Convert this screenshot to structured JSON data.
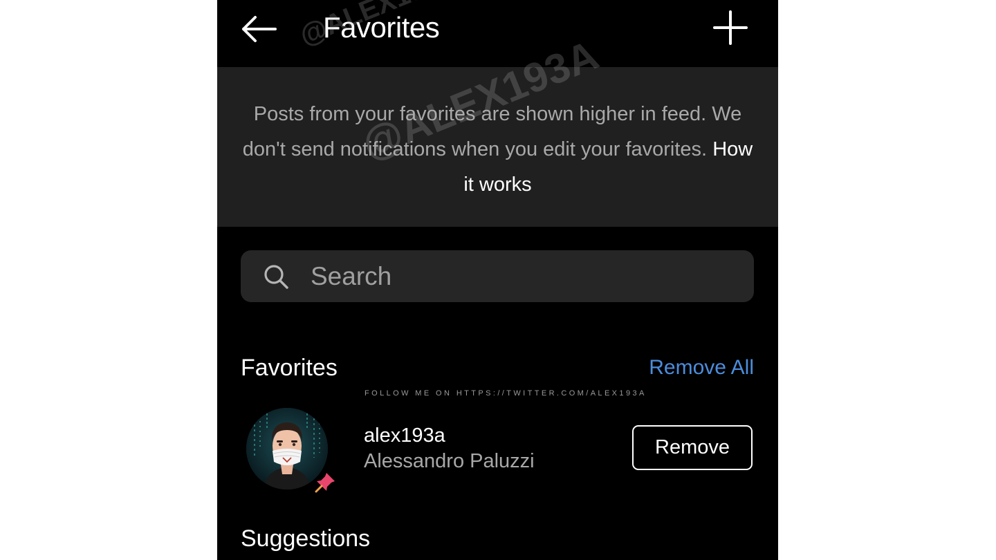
{
  "header": {
    "title": "Favorites",
    "back_icon": "arrow-left-icon",
    "add_icon": "plus-icon"
  },
  "info": {
    "text": "Posts from your favorites are shown higher in feed. We don't send notifications when you edit your favorites.",
    "link": "How it works"
  },
  "search": {
    "placeholder": "Search",
    "icon": "search-icon"
  },
  "favorites_section": {
    "title": "Favorites",
    "remove_all_label": "Remove All",
    "items": [
      {
        "username": "alex193a",
        "full_name": "Alessandro Paluzzi",
        "remove_label": "Remove"
      }
    ]
  },
  "suggestions_section": {
    "title": "Suggestions"
  },
  "watermark": {
    "handle": "@ALEX193A",
    "footer": "FOLLOW ME ON HTTPS://TWITTER.COM/ALEX193A"
  },
  "colors": {
    "background": "#000000",
    "info_box": "#202020",
    "search_bg": "#262626",
    "accent_link": "#4c8ddc"
  }
}
